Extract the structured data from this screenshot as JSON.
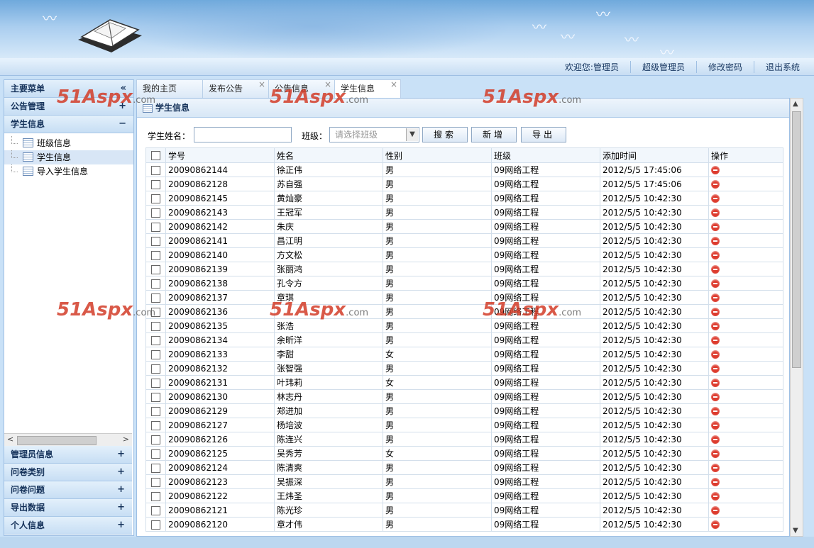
{
  "header": {
    "links": [
      "欢迎您:管理员",
      "超级管理员",
      "修改密码",
      "退出系统"
    ]
  },
  "sidebar": {
    "main_menu_label": "主要菜单",
    "collapse_icon": "«",
    "groups_top": [
      {
        "label": "公告管理",
        "toggle": "+"
      },
      {
        "label": "学生信息",
        "toggle": "−"
      }
    ],
    "tree_items": [
      "班级信息",
      "学生信息",
      "导入学生信息"
    ],
    "groups_bottom": [
      {
        "label": "管理员信息",
        "toggle": "+"
      },
      {
        "label": "问卷类别",
        "toggle": "+"
      },
      {
        "label": "问卷问题",
        "toggle": "+"
      },
      {
        "label": "导出数据",
        "toggle": "+"
      },
      {
        "label": "个人信息",
        "toggle": "+"
      }
    ]
  },
  "tabs": [
    "我的主页",
    "发布公告",
    "公告信息",
    "学生信息"
  ],
  "panel": {
    "title": "学生信息",
    "search_name_label": "学生姓名：",
    "class_label": "班级：",
    "class_placeholder": "请选择班级",
    "search_button": "搜索",
    "add_button": "新增",
    "export_button": "导出"
  },
  "table": {
    "columns": [
      "学号",
      "姓名",
      "性别",
      "班级",
      "添加时间",
      "操作"
    ],
    "rows": [
      [
        "20090862144",
        "徐正伟",
        "男",
        "09网络工程",
        "2012/5/5 17:45:06"
      ],
      [
        "20090862128",
        "苏自强",
        "男",
        "09网络工程",
        "2012/5/5 17:45:06"
      ],
      [
        "20090862145",
        "黄灿豪",
        "男",
        "09网络工程",
        "2012/5/5 10:42:30"
      ],
      [
        "20090862143",
        "王冠军",
        "男",
        "09网络工程",
        "2012/5/5 10:42:30"
      ],
      [
        "20090862142",
        "朱庆",
        "男",
        "09网络工程",
        "2012/5/5 10:42:30"
      ],
      [
        "20090862141",
        "昌江明",
        "男",
        "09网络工程",
        "2012/5/5 10:42:30"
      ],
      [
        "20090862140",
        "方文松",
        "男",
        "09网络工程",
        "2012/5/5 10:42:30"
      ],
      [
        "20090862139",
        "张丽鸿",
        "男",
        "09网络工程",
        "2012/5/5 10:42:30"
      ],
      [
        "20090862138",
        "孔令方",
        "男",
        "09网络工程",
        "2012/5/5 10:42:30"
      ],
      [
        "20090862137",
        "章琪",
        "男",
        "09网络工程",
        "2012/5/5 10:42:30"
      ],
      [
        "20090862136",
        "",
        "男",
        "09网络工程",
        "2012/5/5 10:42:30"
      ],
      [
        "20090862135",
        "张浩",
        "男",
        "09网络工程",
        "2012/5/5 10:42:30"
      ],
      [
        "20090862134",
        "余昕洋",
        "男",
        "09网络工程",
        "2012/5/5 10:42:30"
      ],
      [
        "20090862133",
        "李甜",
        "女",
        "09网络工程",
        "2012/5/5 10:42:30"
      ],
      [
        "20090862132",
        "张智强",
        "男",
        "09网络工程",
        "2012/5/5 10:42:30"
      ],
      [
        "20090862131",
        "叶玮莉",
        "女",
        "09网络工程",
        "2012/5/5 10:42:30"
      ],
      [
        "20090862130",
        "林志丹",
        "男",
        "09网络工程",
        "2012/5/5 10:42:30"
      ],
      [
        "20090862129",
        "郑进加",
        "男",
        "09网络工程",
        "2012/5/5 10:42:30"
      ],
      [
        "20090862127",
        "杨培波",
        "男",
        "09网络工程",
        "2012/5/5 10:42:30"
      ],
      [
        "20090862126",
        "陈连兴",
        "男",
        "09网络工程",
        "2012/5/5 10:42:30"
      ],
      [
        "20090862125",
        "吴秀芳",
        "女",
        "09网络工程",
        "2012/5/5 10:42:30"
      ],
      [
        "20090862124",
        "陈清爽",
        "男",
        "09网络工程",
        "2012/5/5 10:42:30"
      ],
      [
        "20090862123",
        "吴振深",
        "男",
        "09网络工程",
        "2012/5/5 10:42:30"
      ],
      [
        "20090862122",
        "王炜圣",
        "男",
        "09网络工程",
        "2012/5/5 10:42:30"
      ],
      [
        "20090862121",
        "陈光珍",
        "男",
        "09网络工程",
        "2012/5/5 10:42:30"
      ],
      [
        "20090862120",
        "章才伟",
        "男",
        "09网络工程",
        "2012/5/5 10:42:30"
      ]
    ]
  },
  "watermark": {
    "main": "51Aspx",
    "suffix": ".com"
  }
}
